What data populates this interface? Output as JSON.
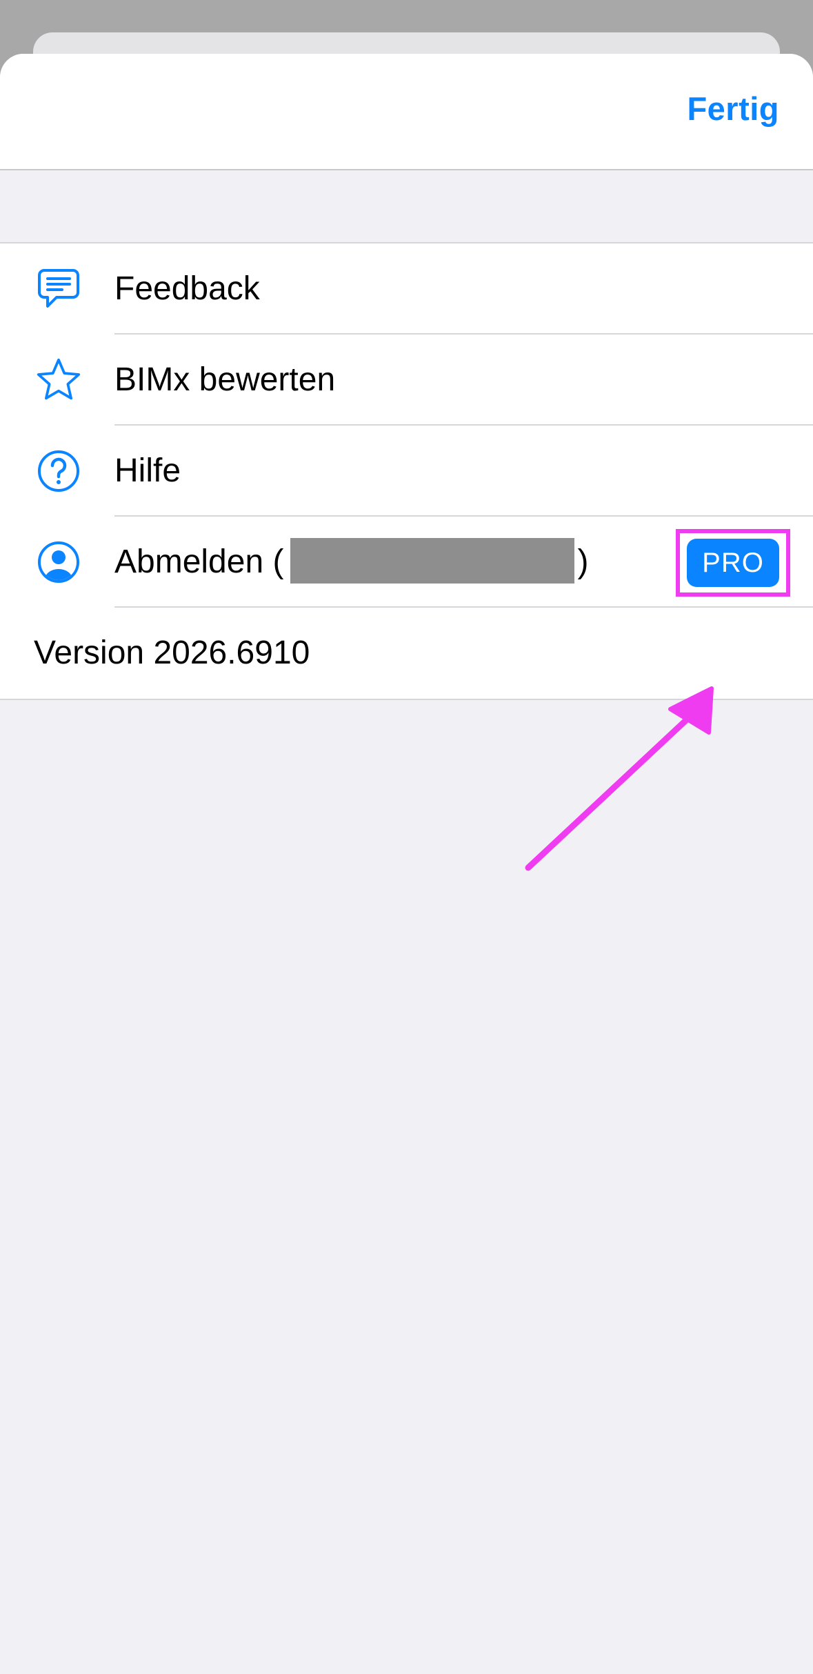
{
  "navbar": {
    "done_label": "Fertig"
  },
  "menu": {
    "items": [
      {
        "label": "Feedback",
        "icon": "chat-bubble-icon"
      },
      {
        "label": "BIMx bewerten",
        "icon": "star-icon"
      },
      {
        "label": "Hilfe",
        "icon": "question-circle-icon"
      },
      {
        "label_prefix": "Abmelden (",
        "label_suffix": ")",
        "icon": "user-circle-icon",
        "badge": "PRO"
      }
    ],
    "version": "Version 2026.6910"
  },
  "colors": {
    "accent": "#0a84ff",
    "annotation": "#f03cf0",
    "redaction": "#8e8e8e"
  }
}
